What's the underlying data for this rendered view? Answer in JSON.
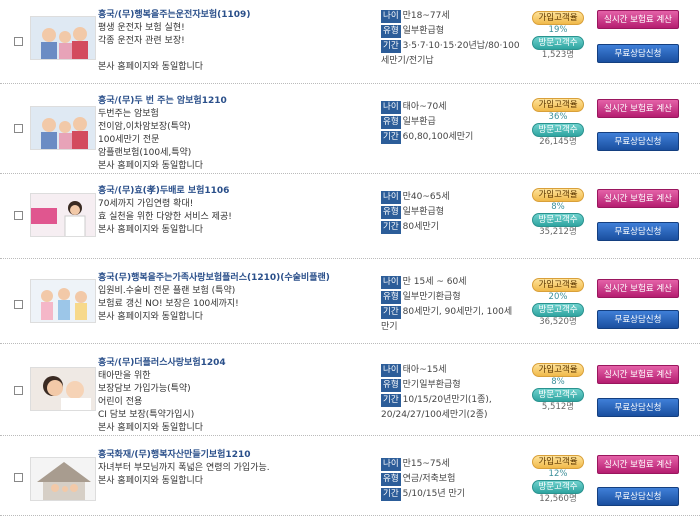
{
  "items": [
    {
      "title": "흥국/(무)행복을주는운전자보험(1109)",
      "lines": [
        "평생 운전자 보험 실현!",
        "각종 운전자 관련 보장!",
        "",
        "본사 홈페이지와 동일합니다"
      ],
      "age": "만18~77세",
      "type": "일부환급형",
      "term_lines": [
        "3·5·7·10·15·20년납/80·100",
        "세만기/전기납"
      ],
      "rate": "19%",
      "visitors": "1,523명",
      "thumb": "family"
    },
    {
      "title": "흥국/(무)두 번 주는 암보험1210",
      "lines": [
        "두번주는 암보험",
        "전이암,이차암보장(특약)",
        "100세만기 전문",
        "암플랜보험(100세,특약)",
        "본사 홈페이지와 동일합니다"
      ],
      "age": "태아~70세",
      "type": "일부환급",
      "term_lines": [
        "60,80,100세만기"
      ],
      "rate": "36%",
      "visitors": "26,145명",
      "thumb": "family"
    },
    {
      "title": "흥국/(무)효(孝)두배로 보험1106",
      "lines": [
        "70세까지 가입연령 확대!",
        "효 실천을 위한 다양한 서비스 제공!",
        "본사 홈페이지와 동일합니다"
      ],
      "age": "만40~65세",
      "type": "일부환급형",
      "term_lines": [
        "80세만기"
      ],
      "rate": "8%",
      "visitors": "35,212명",
      "thumb": "woman"
    },
    {
      "title": "흥국(무)행복을주는가족사랑보험플러스(1210)(수술비플랜)",
      "lines": [
        "입원비.수술비 전문 플랜 보험 (특약)",
        "보험료 갱신 NO! 보장은 100세까지!",
        "본사 홈페이지와 동일합니다"
      ],
      "age": "만 15세 ~ 60세",
      "type": "일부만기환급형",
      "term_lines": [
        "80세만기, 90세만기, 100세",
        "만기"
      ],
      "rate": "20%",
      "visitors": "36,520명",
      "thumb": "kids"
    },
    {
      "title": "흥국/(무)더플러스사랑보험1204",
      "lines": [
        "태아만을 위한",
        "보장담보 가입가능(특약)",
        "어린이 전용",
        "CI 담보 보장(특약가입시)",
        "본사 홈페이지와 동일합니다"
      ],
      "age": "태아~15세",
      "type": "만기일부환급형",
      "term_lines": [
        "10/15/20년만기(1종),",
        "20/24/27/100세만기(2종)"
      ],
      "rate": "8%",
      "visitors": "5,512명",
      "thumb": "baby"
    },
    {
      "title": "흥국화재/(무)행복자산만들기보험1210",
      "lines": [
        "자녀부터 부모님까지 폭넓은 연령의 가입가능.",
        "본사 홈페이지와 동일합니다"
      ],
      "age": "만15~75세",
      "type": "연금/저축보험",
      "term_lines": [
        "5/10/15년 만기"
      ],
      "rate": "12%",
      "visitors": "12,560명",
      "thumb": "house"
    }
  ],
  "labels": {
    "age": "나이",
    "type": "유형",
    "term": "기간",
    "rate": "가입고객율",
    "visitors": "방문고객수",
    "calc_button": "실시간 보험료 계산",
    "consult_button": "무료상담신청"
  },
  "colors": {
    "title": "#2a4f8a",
    "tag": "#2c5d99",
    "calc": "#c42a80",
    "consult": "#1f58ad"
  }
}
